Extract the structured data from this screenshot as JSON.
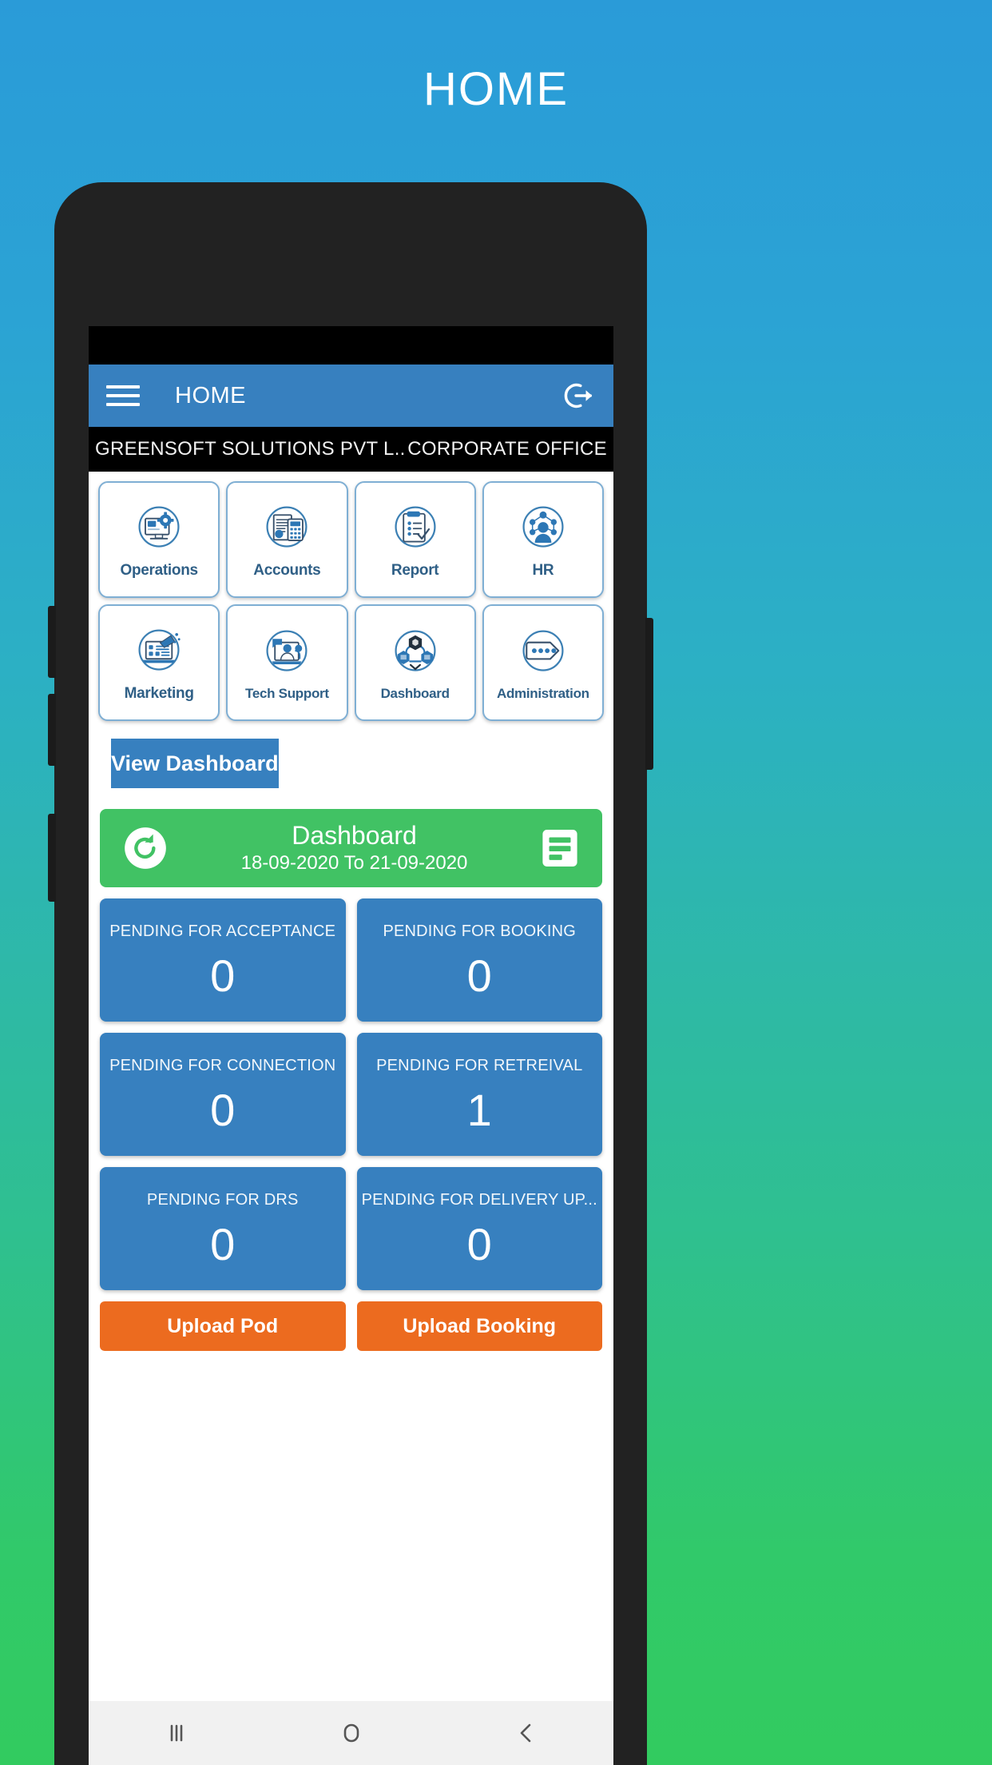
{
  "page": {
    "title": "HOME"
  },
  "appbar": {
    "title": "HOME",
    "menu_icon": "hamburger-menu-icon",
    "logout_icon": "logout-icon",
    "bg_color": "#3780bf"
  },
  "company_strip": {
    "company": "GREENSOFT SOLUTIONS PVT L..",
    "branch": "CORPORATE OFFICE"
  },
  "menu_tiles": [
    {
      "label": "Operations",
      "icon": "monitor-gear-icon"
    },
    {
      "label": "Accounts",
      "icon": "invoice-calculator-icon"
    },
    {
      "label": "Report",
      "icon": "clipboard-check-icon"
    },
    {
      "label": "HR",
      "icon": "people-network-icon"
    },
    {
      "label": "Marketing",
      "icon": "laptop-megaphone-icon"
    },
    {
      "label": "Tech Support",
      "icon": "support-agent-icon"
    },
    {
      "label": "Dashboard",
      "icon": "nodes-cube-icon"
    },
    {
      "label": "Administration",
      "icon": "tag-dots-icon"
    }
  ],
  "view_dashboard": {
    "label": "View Dashboard"
  },
  "green_banner": {
    "title": "Dashboard",
    "date_range": "18-09-2020 To 21-09-2020",
    "refresh_icon": "refresh-icon",
    "list_icon": "list-article-icon",
    "bg_color": "#41c264"
  },
  "stat_cards": [
    {
      "label": "PENDING FOR ACCEPTANCE",
      "value": "0"
    },
    {
      "label": "PENDING FOR BOOKING",
      "value": "0"
    },
    {
      "label": "PENDING FOR CONNECTION",
      "value": "0"
    },
    {
      "label": "PENDING FOR RETREIVAL",
      "value": "1"
    },
    {
      "label": "PENDING FOR DRS",
      "value": "0"
    },
    {
      "label": "PENDING FOR DELIVERY UP...",
      "value": "0"
    }
  ],
  "upload_buttons": [
    {
      "label": "Upload Pod"
    },
    {
      "label": "Upload Booking"
    }
  ],
  "navbar": {
    "recents_icon": "recents-bars-icon",
    "home_icon": "home-circle-icon",
    "back_icon": "back-chevron-icon"
  },
  "colors": {
    "background_top": "#2a9bd8",
    "background_bottom": "#32cb5f",
    "accent_blue": "#3780bf",
    "accent_green": "#41c264",
    "accent_orange": "#ec6b1f",
    "tile_border": "#7fafd4",
    "tile_text": "#2f5f86"
  }
}
